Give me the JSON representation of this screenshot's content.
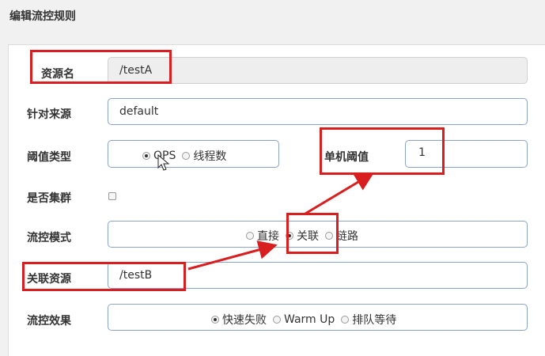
{
  "dialog": {
    "title": "编辑流控规则"
  },
  "form": {
    "resource": {
      "label": "资源名",
      "value": "/testA"
    },
    "limit_app": {
      "label": "针对来源",
      "value": "default"
    },
    "grade": {
      "label": "阈值类型",
      "options": [
        "QPS",
        "线程数"
      ],
      "selected": 0
    },
    "threshold": {
      "label": "单机阈值",
      "value": "1"
    },
    "cluster": {
      "label": "是否集群",
      "checked": false
    },
    "strategy": {
      "label": "流控模式",
      "options": [
        "直接",
        "关联",
        "链路"
      ],
      "selected": 1
    },
    "ref_resource": {
      "label": "关联资源",
      "value": "/testB"
    },
    "control_behavior": {
      "label": "流控效果",
      "options": [
        "快速失败",
        "Warm Up",
        "排队等待"
      ],
      "selected": 0
    }
  },
  "annotation_color": "#d81e1e"
}
